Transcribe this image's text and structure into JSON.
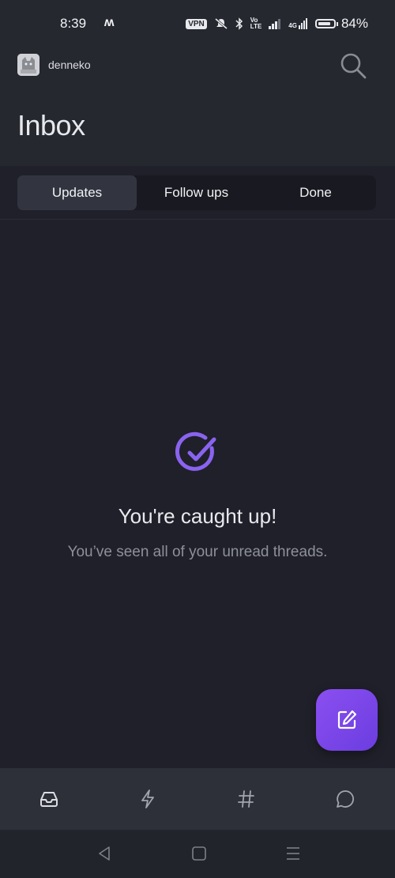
{
  "status": {
    "time": "8:39",
    "carrier_logo": "ʍ",
    "vpn": "VPN",
    "volte_top": "Vo",
    "volte_bottom": "LTE",
    "network": "4G",
    "battery_percent": "84%",
    "battery_level": 0.84
  },
  "header": {
    "username": "denneko",
    "title": "Inbox"
  },
  "tabs": [
    {
      "label": "Updates",
      "active": true
    },
    {
      "label": "Follow ups",
      "active": false
    },
    {
      "label": "Done",
      "active": false
    }
  ],
  "empty": {
    "title": "You're caught up!",
    "subtitle": "You’ve seen all of your unread threads."
  },
  "nav": {
    "items": [
      "inbox-icon",
      "lightning-icon",
      "hash-icon",
      "chat-bubble-icon"
    ]
  },
  "colors": {
    "accent": "#7d5af0",
    "check": "#8a63f0"
  }
}
